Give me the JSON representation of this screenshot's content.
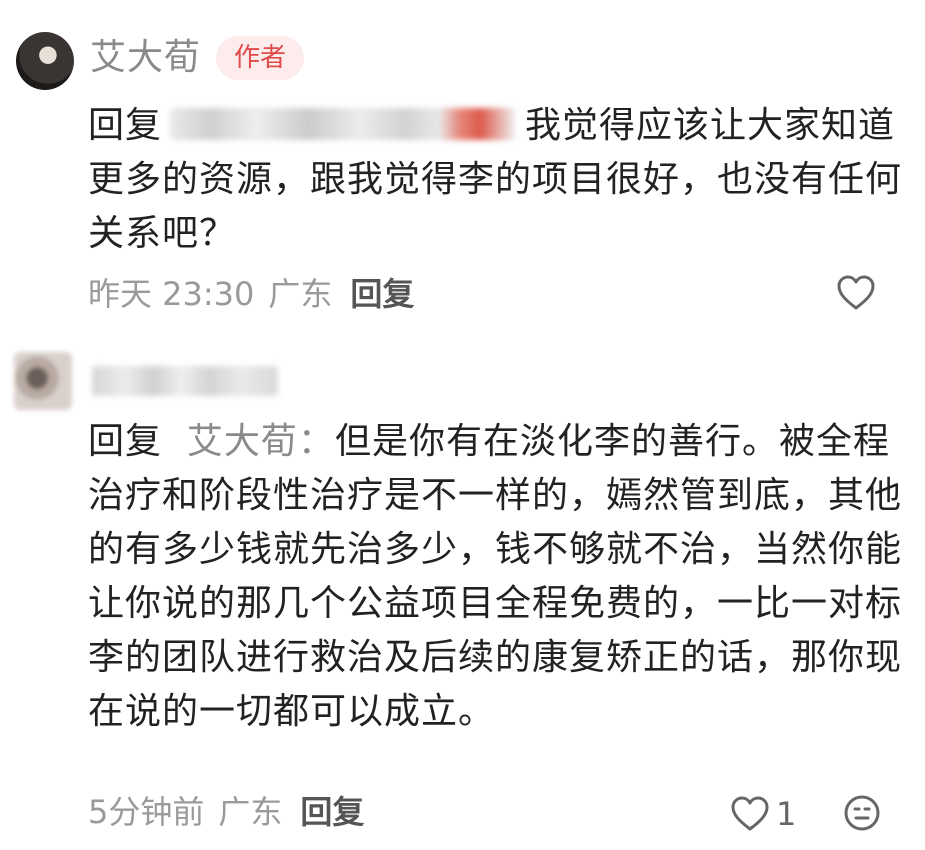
{
  "comments": [
    {
      "username": "艾大荀",
      "badge": "作者",
      "reply_prefix": "回复",
      "text": "我觉得应该让大家知道更多的资源，跟我觉得李的项目很好，也没有任何关系吧？",
      "time": "昨天 23:30",
      "location": "广东",
      "reply_label": "回复",
      "like_count": ""
    },
    {
      "reply_prefix": "回复",
      "mention": "艾大荀",
      "mention_sep": "：",
      "text": "但是你有在淡化李的善行。被全程治疗和阶段性治疗是不一样的，嫣然管到底，其他的有多少钱就先治多少，钱不够就不治，当然你能让你说的那几个公益项目全程免费的，一比一对标李的团队进行救治及后续的康复矫正的话，那你现在说的一切都可以成立。",
      "time": "5分钟前",
      "location": "广东",
      "reply_label": "回复",
      "like_count": "1"
    }
  ],
  "icons": {
    "like": "heart-outline-icon",
    "emoji": "smiley-face-icon"
  },
  "colors": {
    "badge_bg": "#fdecec",
    "badge_text": "#e04a4a",
    "meta_text": "#9a9a9a",
    "name_text": "#8a8a8a"
  }
}
